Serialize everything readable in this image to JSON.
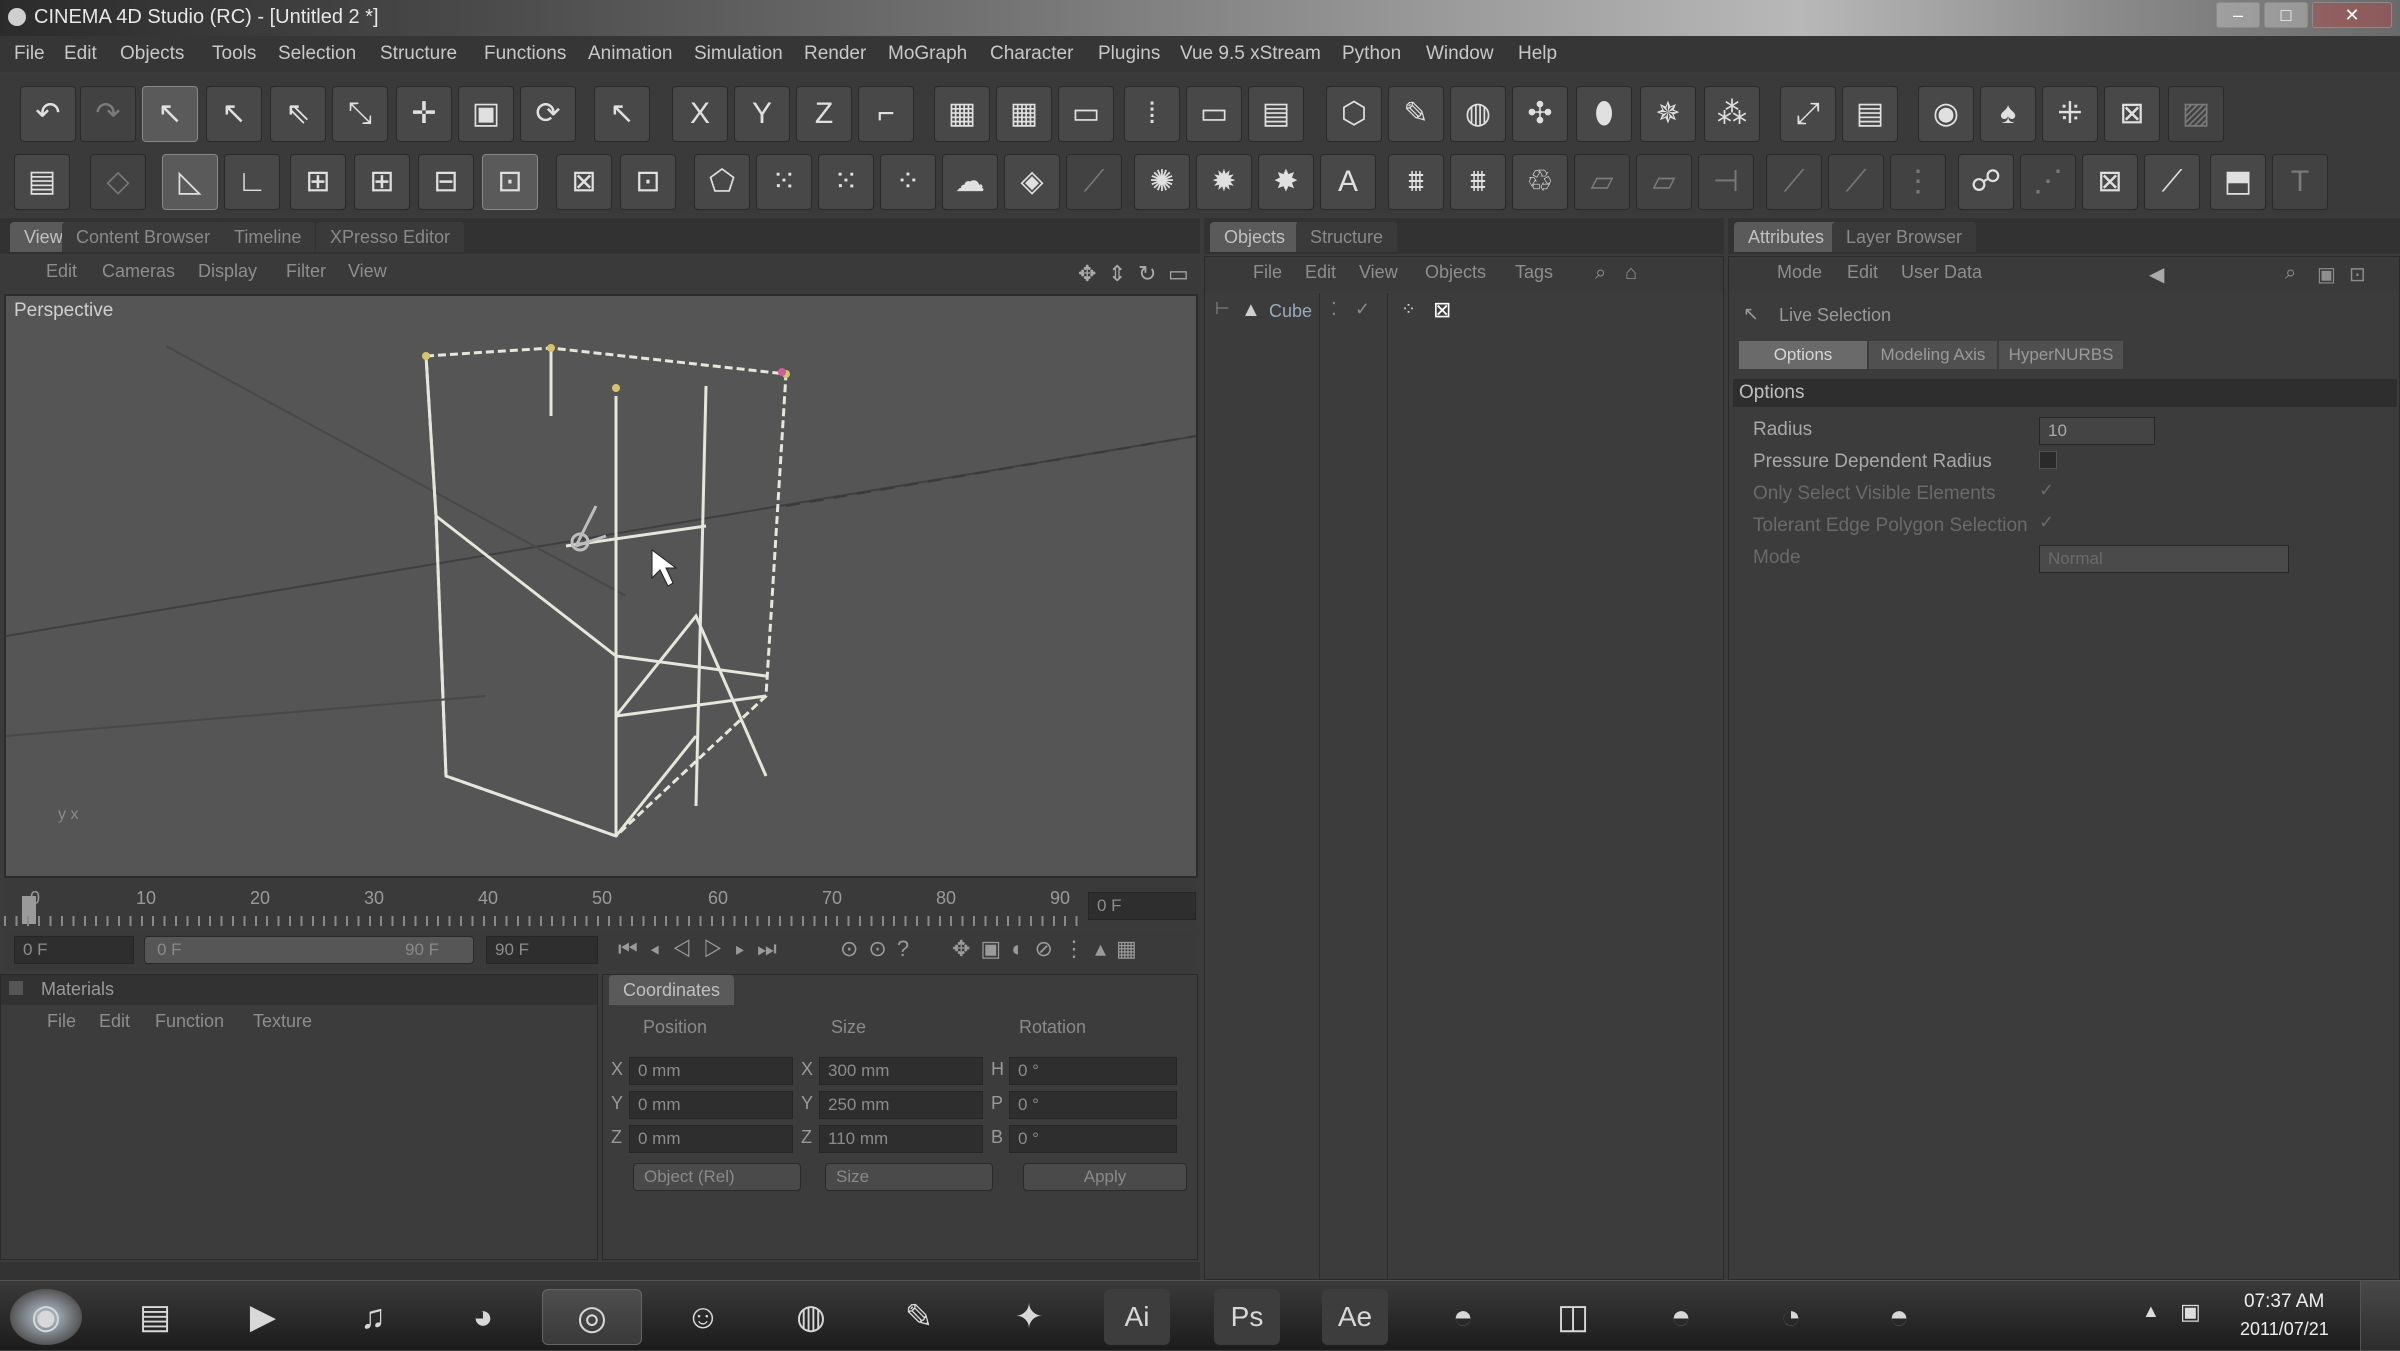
{
  "window": {
    "title": "CINEMA 4D Studio (RC) - [Untitled 2 *]",
    "controls": [
      "–",
      "□",
      "✕"
    ]
  },
  "menu": [
    "File",
    "Edit",
    "Objects",
    "Tools",
    "Selection",
    "Structure",
    "Functions",
    "Animation",
    "Simulation",
    "Render",
    "MoGraph",
    "Character",
    "Plugins",
    "Vue 9.5 xStream",
    "Python",
    "Window",
    "Help"
  ],
  "toolbar1": {
    "groups": [
      [
        "undo-icon",
        "redo-icon"
      ],
      [
        "live-selection-icon",
        "move-icon",
        "scale-icon",
        "rotate-icon",
        "move-cross-icon",
        "box-icon",
        "rotate-circle-icon"
      ],
      [
        "recent-tool-icon"
      ],
      [
        "x-axis-icon",
        "y-axis-icon",
        "z-axis-icon",
        "coordinate-system-icon"
      ],
      [
        "render-view-icon",
        "render-picture-viewer-icon",
        "edit-render-settings-icon",
        "render-region-icon",
        "render-active-icon",
        "render-settings-icon"
      ],
      [
        "cube-icon",
        "spline-pen-icon",
        "nurbs-icon",
        "array-icon",
        "deformer-icon",
        "scene-icon",
        "particles-icon"
      ],
      [
        "camera-icon",
        "light-icon"
      ],
      [
        "hair-icon",
        "character-icon",
        "mograph-icon",
        "effector-icon",
        "hair-grid-icon"
      ]
    ],
    "axes": [
      "X",
      "Y",
      "Z"
    ]
  },
  "toolbar2": {
    "icons": [
      "layout-icon",
      "make-editable-icon",
      "model-mode-icon",
      "object-mode-icon",
      "points-mode-icon",
      "edges-mode-icon",
      "polygons-mode-icon",
      "uv-mode-icon",
      "texture-mode-icon",
      "snap-icon",
      "workplane-icon",
      "knife-icon",
      "magnet-icon",
      "brush-icon",
      "smooth-icon",
      "extrude-icon",
      "bevel-icon",
      "bridge-icon",
      "weld-icon",
      "close-hole-icon",
      "melt-icon",
      "text-icon",
      "polygon-pen-icon",
      "slide-icon",
      "iron-icon",
      "mirror-icon",
      "cut-icon",
      "loop-cut-icon",
      "stitch-icon",
      "skin-icon",
      "pose-icon",
      "paint-icon",
      "joint-icon",
      "sculpt-icon",
      "cube-open-icon",
      "tag-icon"
    ]
  },
  "viewport_panel": {
    "tabs": [
      "View",
      "Content Browser",
      "Timeline",
      "XPresso Editor"
    ],
    "menu": [
      "Edit",
      "Cameras",
      "Display",
      "Filter",
      "View"
    ],
    "label": "Perspective",
    "axis_hint": "y x"
  },
  "object_panel": {
    "tabs": [
      "Objects",
      "Structure"
    ],
    "menu": [
      "File",
      "Edit",
      "View",
      "Objects",
      "Tags"
    ],
    "objects": [
      {
        "name": "Cube"
      }
    ]
  },
  "attributes_panel": {
    "tabs": [
      "Attributes",
      "Layer Browser"
    ],
    "menu": [
      "Mode",
      "Edit",
      "User Data"
    ],
    "tool": "Live Selection",
    "subtabs": [
      "Options",
      "Modeling Axis",
      "HyperNURBS"
    ],
    "section": "Options",
    "rows": [
      {
        "label": "Radius",
        "value": "10",
        "type": "number"
      },
      {
        "label": "Pressure Dependent Radius",
        "value": "",
        "type": "checkbox",
        "checked": false
      },
      {
        "label": "Only Select Visible Elements",
        "value": "",
        "type": "checkbox",
        "checked": true
      },
      {
        "label": "Tolerant Edge Polygon Selection",
        "value": "",
        "type": "checkbox",
        "checked": true
      },
      {
        "label": "Mode",
        "value": "Normal",
        "type": "select"
      }
    ]
  },
  "timeline": {
    "ticks": [
      "0",
      "10",
      "20",
      "30",
      "40",
      "50",
      "60",
      "70",
      "80",
      "90"
    ],
    "current_frame": "0 F",
    "start": "0 F",
    "range_start": "0 F",
    "range_end": "90 F",
    "end": "90 F"
  },
  "materials_panel": {
    "title": "Materials",
    "menu": [
      "File",
      "Edit",
      "Function",
      "Texture"
    ]
  },
  "coordinates_panel": {
    "tab": "Coordinates",
    "headers": [
      "Position",
      "Size",
      "Rotation"
    ],
    "rows": [
      {
        "axis": "X",
        "position": "0 mm",
        "size_axis": "X",
        "size": "300 mm",
        "rot_axis": "H",
        "rotation": "0 °"
      },
      {
        "axis": "Y",
        "position": "0 mm",
        "size_axis": "Y",
        "size": "250 mm",
        "rot_axis": "P",
        "rotation": "0 °"
      },
      {
        "axis": "Z",
        "position": "0 mm",
        "size_axis": "Z",
        "size": "110 mm",
        "rot_axis": "B",
        "rotation": "0 °"
      }
    ],
    "mode": "Object (Rel)",
    "size_mode": "Size",
    "apply": "Apply"
  },
  "taskbar": {
    "apps": [
      {
        "name": "start-orb-icon",
        "glyph": "◉"
      },
      {
        "name": "explorer-icon",
        "glyph": "▤"
      },
      {
        "name": "media-player-icon",
        "glyph": "▶"
      },
      {
        "name": "itunes-icon",
        "glyph": "♫"
      },
      {
        "name": "firefox-icon",
        "glyph": "◕"
      },
      {
        "name": "cinema4d-icon",
        "glyph": "◎"
      },
      {
        "name": "messenger-icon",
        "glyph": "☺"
      },
      {
        "name": "dvd-icon",
        "glyph": "◍"
      },
      {
        "name": "paint-icon",
        "glyph": "✎"
      },
      {
        "name": "dreamweaver-icon",
        "glyph": "✦"
      },
      {
        "name": "illustrator-icon",
        "glyph": "Ai"
      },
      {
        "name": "photoshop-icon",
        "glyph": "Ps"
      },
      {
        "name": "aftereffects-icon",
        "glyph": "Ae"
      },
      {
        "name": "blender-icon",
        "glyph": "◓"
      },
      {
        "name": "scanner-icon",
        "glyph": "◫"
      },
      {
        "name": "blender-2-icon",
        "glyph": "◓"
      },
      {
        "name": "swirl-icon",
        "glyph": "◔"
      },
      {
        "name": "blender-3-icon",
        "glyph": "◓"
      }
    ],
    "time": "07:37 AM",
    "date": "2011/07/21"
  }
}
